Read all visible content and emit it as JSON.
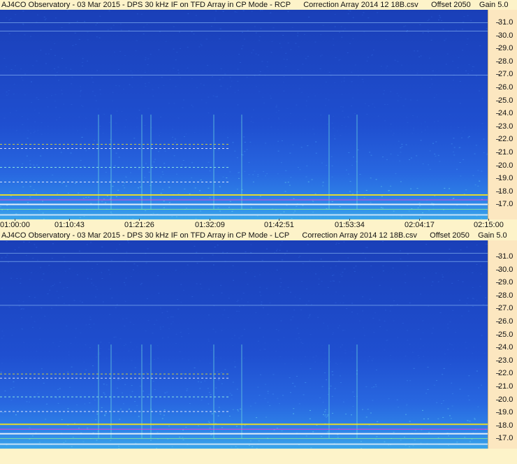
{
  "panels": [
    {
      "title": "AJ4CO Observatory - 03 Mar 2015 - DPS 30 kHz IF on TFD Array in CP Mode - RCP      Correction Array 2014 12 18B.csv      Offset 2050    Gain 5.0",
      "freq_ticks": [
        "31.0",
        "30.0",
        "29.0",
        "28.0",
        "27.0",
        "26.0",
        "25.0",
        "24.0",
        "23.0",
        "22.0",
        "21.0",
        "20.0",
        "19.0",
        "18.0",
        "17.0"
      ]
    },
    {
      "title": "AJ4CO Observatory - 03 Mar 2015 - DPS 30 kHz IF on TFD Array in CP Mode - LCP      Correction Array 2014 12 18B.csv      Offset 2050    Gain 5.0",
      "freq_ticks": [
        "31.0",
        "30.0",
        "29.0",
        "28.0",
        "27.0",
        "26.0",
        "25.0",
        "24.0",
        "23.0",
        "22.0",
        "21.0",
        "20.0",
        "19.0",
        "18.0",
        "17.0"
      ]
    }
  ],
  "time_axis": {
    "ticks": [
      "01:00:00",
      "01:10:43",
      "01:21:26",
      "01:32:09",
      "01:42:51",
      "01:53:34",
      "02:04:17",
      "02:15:00"
    ]
  },
  "colors": {
    "background": "#fdf3c9",
    "spectrogram_dark": "#1a3fb8",
    "spectrogram_mid": "#2867e0",
    "spectrogram_bright": "#3aa6ea",
    "band_yellow": "#f6e51a",
    "band_magenta": "#ff3bd0",
    "band_white": "#ffffff"
  }
}
